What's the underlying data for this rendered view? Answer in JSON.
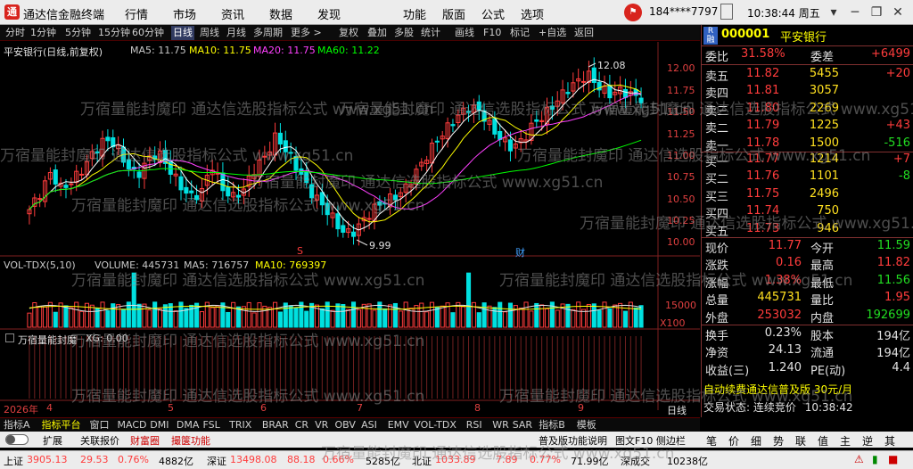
{
  "window": {
    "app_title": "通达信金融终端",
    "menus": [
      "行情",
      "市场",
      "资讯",
      "数据",
      "发现",
      "功能",
      "版面",
      "公式",
      "选项"
    ],
    "account": "184****7797",
    "clock": "10:38:44 周五",
    "logo_char": "通"
  },
  "toolbar": {
    "items": [
      "分时",
      "1分钟",
      "5分钟",
      "15分钟",
      "60分钟",
      "日线",
      "周线",
      "月线",
      "多周期",
      "更多 >",
      "复权",
      "叠加",
      "多股",
      "统计",
      "画线",
      "F10",
      "标记",
      "+自选",
      "返回"
    ],
    "active": "日线"
  },
  "chart": {
    "title": "平安银行(日线,前复权)",
    "ma_legend": [
      {
        "label": "MA5: 11.75",
        "color": "#ffffff"
      },
      {
        "label": "MA10: 11.75",
        "color": "#ffff00"
      },
      {
        "label": "MA20: 11.75",
        "color": "#ff40ff"
      },
      {
        "label": "MA60: 11.22",
        "color": "#00ff00"
      }
    ],
    "y_ticks": [
      "12.00",
      "11.75",
      "11.50",
      "11.25",
      "11.00",
      "10.75",
      "10.50",
      "10.25",
      "10.00"
    ],
    "high_label": "12.08",
    "low_label": "9.99",
    "markers": [
      "S",
      "财"
    ],
    "vol_legend": [
      {
        "label": "VOL-TDX(5,10)",
        "color": "#e0e0e0"
      },
      {
        "label": "VOLUME: 445731",
        "color": "#e0e0e0"
      },
      {
        "label": "MA5: 716757",
        "color": "#e0e0e0"
      },
      {
        "label": "MA10: 769397",
        "color": "#ffff00"
      }
    ],
    "vol_ticks": [
      "15000",
      "X100"
    ],
    "indicator_title": "万宿量能封魔",
    "indicator_value": "XG: 0.00",
    "year": "2026年",
    "months": [
      "4",
      "5",
      "6",
      "7",
      "8",
      "9"
    ],
    "period_label": "日线"
  },
  "chart_data": {
    "type": "candlestick",
    "title": "平安银行(日线,前复权)",
    "ylim": [
      9.95,
      12.15
    ],
    "max_price": 12.08,
    "min_price": 9.99,
    "ma_series": [
      {
        "name": "MA5",
        "color": "#ffffff"
      },
      {
        "name": "MA10",
        "color": "#ffff00"
      },
      {
        "name": "MA20",
        "color": "#ff40ff"
      },
      {
        "name": "MA60",
        "color": "#00ff00"
      }
    ],
    "close_path": [
      10.35,
      10.55,
      10.8,
      10.6,
      10.7,
      10.85,
      11.05,
      11.2,
      11.15,
      10.9,
      10.75,
      10.95,
      11.05,
      10.85,
      10.65,
      10.5,
      10.55,
      10.9,
      10.6,
      10.5,
      10.6,
      10.85,
      11.0,
      11.25,
      11.05,
      10.85,
      10.6,
      10.45,
      10.3,
      10.1,
      10.05,
      10.2,
      10.35,
      10.45,
      10.5,
      10.6,
      10.8,
      11.0,
      11.2,
      11.35,
      11.5,
      11.6,
      11.55,
      11.35,
      11.2,
      11.1,
      11.2,
      11.4,
      11.5,
      11.65,
      11.8,
      11.9,
      12.0,
      11.85,
      11.75,
      11.8,
      11.75,
      11.7
    ],
    "volume_series_name": "VOLUME"
  },
  "quote": {
    "code": "000001",
    "name": "平安银行",
    "weibi_label": "委比",
    "weibi": "31.58%",
    "weicha_label": "委差",
    "weicha": "+6499",
    "asks": [
      {
        "label": "卖五",
        "price": "11.82",
        "vol": "5455",
        "chg": "+20"
      },
      {
        "label": "卖四",
        "price": "11.81",
        "vol": "3057",
        "chg": ""
      },
      {
        "label": "卖三",
        "price": "11.80",
        "vol": "2269",
        "chg": ""
      },
      {
        "label": "卖二",
        "price": "11.79",
        "vol": "1225",
        "chg": "+43"
      },
      {
        "label": "卖一",
        "price": "11.78",
        "vol": "1500",
        "chg": "-516"
      }
    ],
    "bids": [
      {
        "label": "买一",
        "price": "11.77",
        "vol": "1214",
        "chg": "+7"
      },
      {
        "label": "买二",
        "price": "11.76",
        "vol": "1101",
        "chg": "-8"
      },
      {
        "label": "买三",
        "price": "11.75",
        "vol": "2496",
        "chg": ""
      },
      {
        "label": "买四",
        "price": "11.74",
        "vol": "750",
        "chg": ""
      },
      {
        "label": "买五",
        "price": "11.73",
        "vol": "946",
        "chg": ""
      }
    ],
    "stats": [
      {
        "l1": "现价",
        "v1": "11.77",
        "l2": "今开",
        "v2": "11.59"
      },
      {
        "l1": "涨跌",
        "v1": "0.16",
        "l2": "最高",
        "v2": "11.82"
      },
      {
        "l1": "涨幅",
        "v1": "1.38%",
        "l2": "最低",
        "v2": "11.56"
      },
      {
        "l1": "总量",
        "v1": "445731",
        "l2": "量比",
        "v2": "1.95"
      },
      {
        "l1": "外盘",
        "v1": "253032",
        "l2": "内盘",
        "v2": "192699"
      }
    ],
    "stats2": [
      {
        "l1": "换手",
        "v1": "0.23%",
        "l2": "股本",
        "v2": "194亿"
      },
      {
        "l1": "净资",
        "v1": "24.13",
        "l2": "流通",
        "v2": "194亿"
      },
      {
        "l1": "收益(三)",
        "v1": "1.240",
        "l2": "PE(动)",
        "v2": "4.4"
      }
    ],
    "notice": "自动续费通达信普及版  30元/月",
    "trade_state_label": "交易状态:",
    "trade_state": "连续竞价",
    "trade_time": "10:38:42",
    "actions": [
      "笔",
      "价",
      "细",
      "势",
      "联",
      "值",
      "主",
      "逆",
      "其"
    ]
  },
  "indicator_tabs": {
    "items": [
      "指标A",
      "指标平台",
      "窗口",
      "MACD",
      "DMI",
      "DMA",
      "FSL",
      "TRIX",
      "BRAR",
      "CR",
      "VR",
      "OBV",
      "ASI",
      "EMV",
      "VOL-TDX",
      "RSI",
      "WR",
      "SAR",
      "指标B",
      "模板"
    ],
    "active": "指标平台"
  },
  "bar2": {
    "expand": "扩展",
    "items": [
      "关联报价",
      "财富圈",
      "撮箧功能"
    ],
    "right_text": "普及版功能说明",
    "f10": "图文F10 侧边栏"
  },
  "status": {
    "items": [
      {
        "name": "上证",
        "value": "3905.13",
        "chg": "29.53",
        "pct": "0.76%",
        "amt": "4882亿"
      },
      {
        "name": "深证",
        "value": "13498.08",
        "chg": "88.18",
        "pct": "0.66%",
        "amt": "5285亿"
      },
      {
        "name": "北证",
        "value": "1033.89",
        "chg": "7.89",
        "pct": "0.77%",
        "amt": "71.99亿"
      }
    ],
    "extra1": "10238亿",
    "connection": "深成交"
  },
  "watermark": "万宿量能封魔印 通达信选股指标公式 www.xg51.cn",
  "colors": {
    "up": "#ff3c3c",
    "down": "#00e0e0",
    "bg": "#000000",
    "ma5": "#ffffff",
    "ma10": "#ffff00",
    "ma20": "#ff40ff",
    "ma60": "#00ff00"
  }
}
